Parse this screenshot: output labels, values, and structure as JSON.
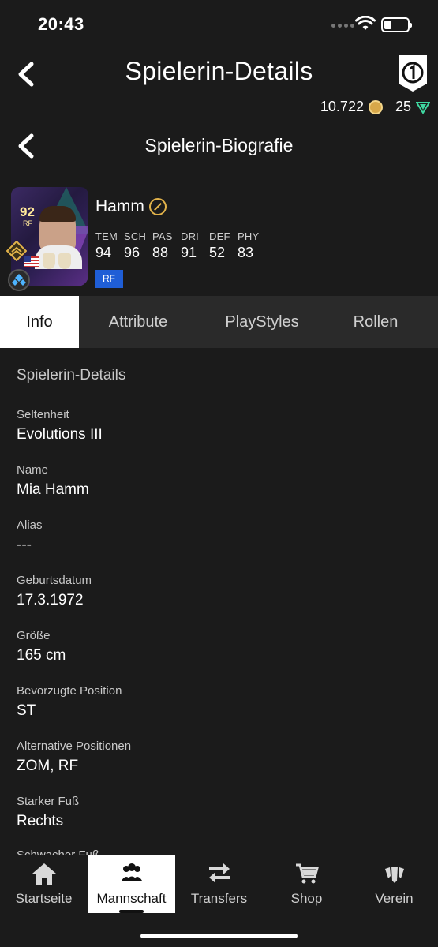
{
  "status": {
    "time": "20:43"
  },
  "header": {
    "title": "Spielerin-Details"
  },
  "currency": {
    "coins": "10.722",
    "points": "25"
  },
  "subheader": {
    "title": "Spielerin-Biografie"
  },
  "player": {
    "name": "Hamm",
    "card_rating": "92",
    "card_position": "RF",
    "position_chip": "RF",
    "stats": [
      {
        "label": "TEM",
        "value": "94"
      },
      {
        "label": "SCH",
        "value": "96"
      },
      {
        "label": "PAS",
        "value": "88"
      },
      {
        "label": "DRI",
        "value": "91"
      },
      {
        "label": "DEF",
        "value": "52"
      },
      {
        "label": "PHY",
        "value": "83"
      }
    ]
  },
  "tabs": [
    {
      "label": "Info",
      "active": true
    },
    {
      "label": "Attribute"
    },
    {
      "label": "PlayStyles"
    },
    {
      "label": "Rollen"
    }
  ],
  "details": {
    "section_title": "Spielerin-Details",
    "fields": [
      {
        "label": "Seltenheit",
        "value": "Evolutions III"
      },
      {
        "label": "Name",
        "value": "Mia Hamm"
      },
      {
        "label": "Alias",
        "value": "---"
      },
      {
        "label": "Geburtsdatum",
        "value": "17.3.1972"
      },
      {
        "label": "Größe",
        "value": "165 cm"
      },
      {
        "label": "Bevorzugte Position",
        "value": "ST"
      },
      {
        "label": "Alternative Positionen",
        "value": "ZOM, RF"
      },
      {
        "label": "Starker Fuß",
        "value": "Rechts"
      },
      {
        "label": "Schwacher Fuß",
        "value": ""
      }
    ]
  },
  "bottom_nav": [
    {
      "label": "Startseite",
      "icon": "home-icon"
    },
    {
      "label": "Mannschaft",
      "icon": "team-icon",
      "active": true
    },
    {
      "label": "Transfers",
      "icon": "transfers-icon"
    },
    {
      "label": "Shop",
      "icon": "shop-icon"
    },
    {
      "label": "Verein",
      "icon": "club-icon"
    }
  ]
}
